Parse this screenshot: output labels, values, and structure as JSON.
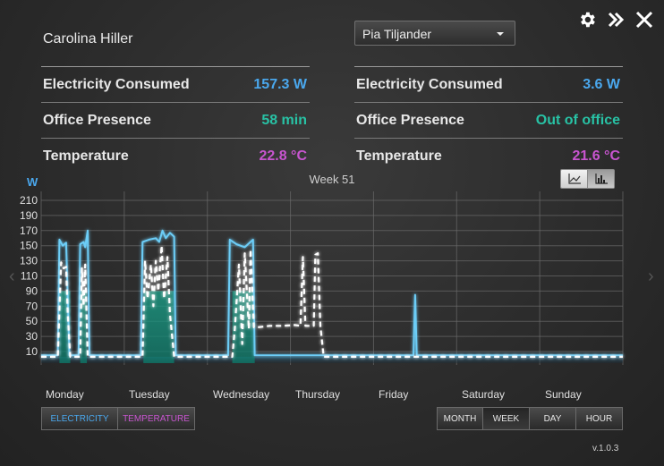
{
  "person": {
    "name": "Carolina Hiller"
  },
  "selector": {
    "value": "Pia Tiljander"
  },
  "top_icons": [
    "gear-icon",
    "double-chevron-right-icon",
    "close-icon"
  ],
  "left_metrics": [
    {
      "label": "Electricity Consumed",
      "value": "157.3 W",
      "color": "#4aa8ee"
    },
    {
      "label": "Office Presence",
      "value": "58 min",
      "color": "#28c2a5"
    },
    {
      "label": "Temperature",
      "value": "22.8 °C",
      "color": "#c855d0"
    }
  ],
  "right_metrics": [
    {
      "label": "Electricity Consumed",
      "value": "3.6 W",
      "color": "#4aa8ee"
    },
    {
      "label": "Office Presence",
      "value": "Out of office",
      "color": "#28c2a5"
    },
    {
      "label": "Temperature",
      "value": "21.6 °C",
      "color": "#c855d0"
    }
  ],
  "chart": {
    "unit": "W",
    "week_label": "Week 51",
    "type_toggle": [
      "line-chart-icon",
      "bar-chart-icon"
    ],
    "days": [
      "Monday",
      "Tuesday",
      "Wednesday",
      "Thursday",
      "Friday",
      "Saturday",
      "Sunday"
    ]
  },
  "series_buttons": {
    "electricity": "ELECTRICITY",
    "temperature": "TEMPERATURE"
  },
  "range_buttons": {
    "month": "MONTH",
    "week": "WEEK",
    "day": "DAY",
    "hour": "HOUR",
    "selected": "WEEK"
  },
  "version": "v.1.0.3",
  "chart_data": {
    "type": "line",
    "title": "Week 51",
    "ylabel": "W",
    "ylim": [
      0,
      220
    ],
    "yticks": [
      10,
      30,
      50,
      70,
      90,
      110,
      130,
      150,
      170,
      190,
      210
    ],
    "xlim": [
      0,
      7
    ],
    "grid": true,
    "series": [
      {
        "color": "#6ccdf7",
        "style": "solid",
        "points": [
          [
            0,
            5
          ],
          [
            0.2,
            5
          ],
          [
            0.22,
            158
          ],
          [
            0.26,
            150
          ],
          [
            0.3,
            154
          ],
          [
            0.34,
            5
          ],
          [
            0.45,
            5
          ],
          [
            0.47,
            152
          ],
          [
            0.51,
            155
          ],
          [
            0.53,
            148
          ],
          [
            0.56,
            170
          ],
          [
            0.58,
            5
          ],
          [
            1.2,
            5
          ],
          [
            1.22,
            155
          ],
          [
            1.3,
            158
          ],
          [
            1.38,
            160
          ],
          [
            1.42,
            155
          ],
          [
            1.46,
            170
          ],
          [
            1.5,
            160
          ],
          [
            1.55,
            167
          ],
          [
            1.6,
            162
          ],
          [
            1.62,
            5
          ],
          [
            2.25,
            5
          ],
          [
            2.27,
            158
          ],
          [
            2.35,
            152
          ],
          [
            2.45,
            148
          ],
          [
            2.55,
            158
          ],
          [
            2.57,
            5
          ],
          [
            3.0,
            5
          ],
          [
            4.48,
            5
          ],
          [
            4.5,
            85
          ],
          [
            4.52,
            5
          ],
          [
            7.0,
            5
          ]
        ]
      },
      {
        "color": "#ffffff",
        "style": "dashed",
        "points": [
          [
            0,
            3
          ],
          [
            0.2,
            3
          ],
          [
            0.24,
            128
          ],
          [
            0.27,
            120
          ],
          [
            0.3,
            122
          ],
          [
            0.32,
            60
          ],
          [
            0.35,
            3
          ],
          [
            0.47,
            3
          ],
          [
            0.49,
            120
          ],
          [
            0.51,
            70
          ],
          [
            0.53,
            125
          ],
          [
            0.56,
            3
          ],
          [
            1.22,
            3
          ],
          [
            1.25,
            130
          ],
          [
            1.28,
            80
          ],
          [
            1.32,
            125
          ],
          [
            1.35,
            70
          ],
          [
            1.38,
            130
          ],
          [
            1.41,
            90
          ],
          [
            1.45,
            150
          ],
          [
            1.48,
            80
          ],
          [
            1.52,
            135
          ],
          [
            1.55,
            60
          ],
          [
            1.6,
            3
          ],
          [
            2.3,
            3
          ],
          [
            2.33,
            40
          ],
          [
            2.38,
            125
          ],
          [
            2.42,
            20
          ],
          [
            2.45,
            140
          ],
          [
            2.5,
            40
          ],
          [
            2.52,
            145
          ],
          [
            2.56,
            42
          ],
          [
            2.6,
            42
          ],
          [
            2.75,
            44
          ],
          [
            2.9,
            44
          ],
          [
            3.05,
            45
          ],
          [
            3.12,
            44
          ],
          [
            3.15,
            135
          ],
          [
            3.18,
            44
          ],
          [
            3.28,
            44
          ],
          [
            3.3,
            138
          ],
          [
            3.33,
            140
          ],
          [
            3.36,
            44
          ],
          [
            3.4,
            3
          ],
          [
            4.0,
            3
          ],
          [
            7.0,
            3
          ]
        ]
      }
    ],
    "presence_bands": [
      [
        0.22,
        0.35
      ],
      [
        0.47,
        0.55
      ],
      [
        1.23,
        1.6
      ],
      [
        2.3,
        2.57
      ]
    ]
  }
}
